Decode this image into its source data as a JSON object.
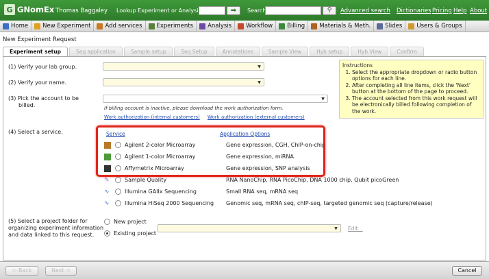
{
  "header": {
    "app_name": "GNomEx",
    "user_name": "Thomas Baggaley",
    "lookup_label": "Lookup Experiment or Analysis by #",
    "search_label": "Search",
    "links": [
      "Advanced search",
      "Dictionaries",
      "Pricing",
      "Help",
      "About"
    ]
  },
  "nav": [
    {
      "label": "Home",
      "icon": "home-icon",
      "color": "#3a6fc4"
    },
    {
      "label": "New Experiment",
      "icon": "experiment-icon",
      "color": "#e0a020"
    },
    {
      "label": "Add services",
      "icon": "flask-icon",
      "color": "#c87a20"
    },
    {
      "label": "Experiments",
      "icon": "beaker-icon",
      "color": "#5a7f3a"
    },
    {
      "label": "Analysis",
      "icon": "analysis-icon",
      "color": "#6c4ba8"
    },
    {
      "label": "Workflow",
      "icon": "workflow-icon",
      "color": "#c44a2a"
    },
    {
      "label": "Billing",
      "icon": "billing-icon",
      "color": "#3a8a3a"
    },
    {
      "label": "Materials & Meth.",
      "icon": "materials-icon",
      "color": "#b06020"
    },
    {
      "label": "Slides",
      "icon": "slides-icon",
      "color": "#5a6a9a"
    },
    {
      "label": "Users & Groups",
      "icon": "users-icon",
      "color": "#d09a30"
    }
  ],
  "panel_title": "New Experiment Request",
  "tabs": [
    "Experiment setup",
    "Seq application",
    "Sample setup",
    "Seq Setup",
    "Annotations",
    "Sample View",
    "Hyb setup",
    "Hyb View",
    "Confirm"
  ],
  "questions": {
    "q1": "(1) Verify your lab group.",
    "q2": "(2) Verify your name.",
    "q3_line1": "(3) Pick the account to be",
    "q3_line2": "billed.",
    "q4": "(4) Select a service.",
    "q5_line1": "(5) Select a project folder for",
    "q5_line2": "organizing experiment information",
    "q5_line3": "and data linked to this request."
  },
  "billing": {
    "note": "If billing account is inactive, please download the work authorization form.",
    "link_internal": "Work authorization (internal customers)",
    "link_external": "Work authorization (external customers)"
  },
  "instructions": {
    "title": "Instructions",
    "items": [
      "Select the appropriate dropdown or radio button options for each line.",
      "After completing all line items, click the 'Next' button at the bottom of the page to proceed.",
      "The account selected from this work request will be electronically billed following completion of the work."
    ]
  },
  "services": {
    "header_service": "Service",
    "header_options": "Application Options",
    "rows": [
      {
        "name": "Agilent 2-color Microarray",
        "options": "Gene expression, CGH, ChIP-on-chip",
        "icon": "two-color-chip-icon"
      },
      {
        "name": "Agilent 1-color Microarray",
        "options": "Gene expression, miRNA",
        "icon": "one-color-chip-icon"
      },
      {
        "name": "Affymetrix Microarray",
        "options": "Gene expression, SNP analysis",
        "icon": "affy-chip-icon"
      },
      {
        "name": "Sample Quality",
        "options": "RNA NanoChip, RNA PicoChip, DNA 1000 chip, Qubit picoGreen",
        "icon": "sample-quality-icon"
      },
      {
        "name": "Illumina GAIIx Sequencing",
        "options": "Small RNA seq, mRNA seq",
        "icon": "dna-icon"
      },
      {
        "name": "Illumina HiSeq 2000 Sequencing",
        "options": "Genomic seq, mRNA seq, chIP-seq, targeted genomic seq (capture/release)",
        "icon": "dna-icon"
      }
    ]
  },
  "project": {
    "new_label": "New project",
    "existing_label": "Existing project",
    "selected": "Existing project",
    "edit_label": "Edit..."
  },
  "footer": {
    "back": "Back",
    "next": "Next",
    "cancel": "Cancel"
  },
  "colors": {
    "brand_green": "#2e7a2b",
    "highlight_red": "#e0241b",
    "link_blue": "#224cb0",
    "combo_fill": "#fffbe0",
    "instructions_fill": "#ffffc2"
  }
}
